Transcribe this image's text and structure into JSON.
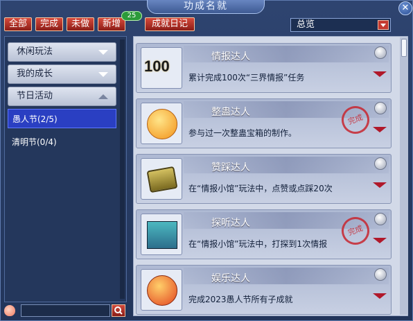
{
  "window": {
    "title": "功成名就"
  },
  "filters": [
    {
      "label": "全部"
    },
    {
      "label": "完成"
    },
    {
      "label": "未做"
    },
    {
      "label": "新增",
      "badge": "25"
    },
    {
      "label": "成就日记"
    }
  ],
  "dropdown": {
    "value": "总览"
  },
  "categories": [
    {
      "label": "休闲玩法"
    },
    {
      "label": "我的成长"
    },
    {
      "label": "节日活动"
    }
  ],
  "subcategories": [
    {
      "label": "愚人节(2/5)",
      "active": true
    },
    {
      "label": "清明节(0/4)",
      "active": false
    }
  ],
  "search": {
    "placeholder": ""
  },
  "achievements": [
    {
      "name": "情报达人",
      "desc": "累计完成100次“三界情报”任务",
      "icon": "hundred-icon",
      "completed": false,
      "icon_text": "100"
    },
    {
      "name": "整蛊达人",
      "desc": "参与过一次整蛊宝箱的制作。",
      "icon": "grin-face-icon",
      "completed": true,
      "stamp": "完成"
    },
    {
      "name": "赞踩达人",
      "desc": "在“情报小馆”玩法中，点赞或点踩20次",
      "icon": "treasure-chest-icon",
      "completed": false
    },
    {
      "name": "探听达人",
      "desc": "在“情报小馆”玩法中，打探到1次情报",
      "icon": "gossip-people-icon",
      "completed": true,
      "stamp": "完成"
    },
    {
      "name": "娱乐达人",
      "desc": "完成2023愚人节所有子成就",
      "icon": "laugh-face-icon",
      "completed": false
    }
  ],
  "colors": {
    "accent_red": "#c43a30",
    "active_blue": "#2a3fc2",
    "panel_bg": "#d2d9e8"
  }
}
